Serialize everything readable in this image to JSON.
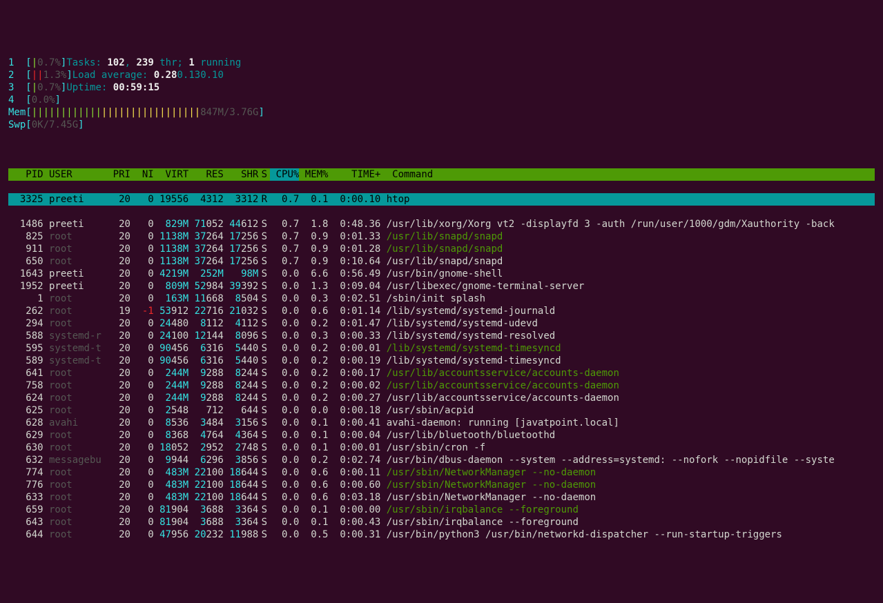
{
  "meters": {
    "cpus": [
      {
        "label": "1",
        "bar": "|",
        "barColor": "green",
        "pct": "0.7%"
      },
      {
        "label": "2",
        "bar": "||",
        "barColor": "red",
        "pct": "1.3%"
      },
      {
        "label": "3",
        "bar": "|",
        "barColor": "green",
        "pct": "0.7%"
      },
      {
        "label": "4",
        "bar": "",
        "barColor": "green",
        "pct": "0.0%"
      }
    ],
    "mem": {
      "label": "Mem",
      "bar": "|||||||||||||||||||||||||||||",
      "used": "847M",
      "total": "3.76G"
    },
    "swp": {
      "label": "Swp",
      "bar": "",
      "used": "0K",
      "total": "7.45G"
    }
  },
  "stats": {
    "tasks_label": "Tasks: ",
    "tasks_procs": "102",
    "tasks_sep": ", ",
    "tasks_thr": "239",
    "tasks_thr_label": " thr; ",
    "tasks_running": "1",
    "tasks_running_label": " running",
    "load_label": "Load average: ",
    "load1": "0.28",
    "load5": "0.13",
    "load15": "0.10",
    "uptime_label": "Uptime: ",
    "uptime": "00:59:15"
  },
  "columns": {
    "pid": "PID",
    "user": "USER",
    "pri": "PRI",
    "ni": "NI",
    "virt": "VIRT",
    "res": "RES",
    "shr": "SHR",
    "s": "S",
    "cpu": "CPU%",
    "mem": "MEM%",
    "time": "TIME+",
    "cmd": "Command"
  },
  "selected": {
    "pid": "3325",
    "user": "preeti",
    "pri": "20",
    "ni": "0",
    "virt": "19556",
    "res": "4312",
    "shr": "3312",
    "s": "R",
    "cpu": "0.7",
    "mem": "0.1",
    "time": "0:00.10",
    "cmd": "htop"
  },
  "processes": [
    {
      "pid": "1486",
      "user": "preeti",
      "userColor": "white",
      "pri": "20",
      "ni": "0",
      "virt": "829M",
      "virtC": "cyan",
      "res_a": "71",
      "res_b": "052",
      "shr_a": "44",
      "shr_b": "612",
      "s": "S",
      "cpu": "0.7",
      "mem": "1.8",
      "time": "0:48.36",
      "cmd": "/usr/lib/xorg/Xorg vt2 -displayfd 3 -auth /run/user/1000/gdm/Xauthority -back",
      "cmdC": "white"
    },
    {
      "pid": "825",
      "user": "root",
      "userColor": "grey",
      "pri": "20",
      "ni": "0",
      "virt": "1138M",
      "virtC": "cyan",
      "res_a": "37",
      "res_b": "264",
      "shr_a": "17",
      "shr_b": "256",
      "s": "S",
      "cpu": "0.7",
      "mem": "0.9",
      "time": "0:01.33",
      "cmd": "/usr/lib/snapd/snapd",
      "cmdC": "green-dim"
    },
    {
      "pid": "911",
      "user": "root",
      "userColor": "grey",
      "pri": "20",
      "ni": "0",
      "virt": "1138M",
      "virtC": "cyan",
      "res_a": "37",
      "res_b": "264",
      "shr_a": "17",
      "shr_b": "256",
      "s": "S",
      "cpu": "0.7",
      "mem": "0.9",
      "time": "0:01.28",
      "cmd": "/usr/lib/snapd/snapd",
      "cmdC": "green-dim"
    },
    {
      "pid": "650",
      "user": "root",
      "userColor": "grey",
      "pri": "20",
      "ni": "0",
      "virt": "1138M",
      "virtC": "cyan",
      "res_a": "37",
      "res_b": "264",
      "shr_a": "17",
      "shr_b": "256",
      "s": "S",
      "cpu": "0.7",
      "mem": "0.9",
      "time": "0:10.64",
      "cmd": "/usr/lib/snapd/snapd",
      "cmdC": "white"
    },
    {
      "pid": "1643",
      "user": "preeti",
      "userColor": "white",
      "pri": "20",
      "ni": "0",
      "virt": "4219M",
      "virtC": "cyan",
      "res_a": "",
      "res_b": "252M",
      "resC": "cyan",
      "shr_a": "",
      "shr_b": "98M",
      "shrC": "cyan",
      "s": "S",
      "cpu": "0.0",
      "mem": "6.6",
      "time": "0:56.49",
      "cmd": "/usr/bin/gnome-shell",
      "cmdC": "white"
    },
    {
      "pid": "1952",
      "user": "preeti",
      "userColor": "white",
      "pri": "20",
      "ni": "0",
      "virt": "809M",
      "virtC": "cyan",
      "res_a": "52",
      "res_b": "984",
      "shr_a": "39",
      "shr_b": "392",
      "s": "S",
      "cpu": "0.0",
      "mem": "1.3",
      "time": "0:09.04",
      "cmd": "/usr/libexec/gnome-terminal-server",
      "cmdC": "white"
    },
    {
      "pid": "1",
      "user": "root",
      "userColor": "grey",
      "pri": "20",
      "ni": "0",
      "virt": "163M",
      "virtC": "cyan",
      "res_a": "11",
      "res_b": "668",
      "shr_a": "8",
      "shr_b": "504",
      "s": "S",
      "cpu": "0.0",
      "mem": "0.3",
      "time": "0:02.51",
      "cmd": "/sbin/init splash",
      "cmdC": "white"
    },
    {
      "pid": "262",
      "user": "root",
      "userColor": "grey",
      "pri": "19",
      "ni": "-1",
      "niC": "red",
      "virt": "53912",
      "virtC": "cyan-split",
      "virt_a": "53",
      "virt_b": "912",
      "res_a": "22",
      "res_b": "716",
      "shr_a": "21",
      "shr_b": "032",
      "s": "S",
      "cpu": "0.0",
      "mem": "0.6",
      "time": "0:01.14",
      "cmd": "/lib/systemd/systemd-journald",
      "cmdC": "white"
    },
    {
      "pid": "294",
      "user": "root",
      "userColor": "grey",
      "pri": "20",
      "ni": "0",
      "virt": "24480",
      "virtC": "cyan-split",
      "virt_a": "24",
      "virt_b": "480",
      "res_a": "8",
      "res_b": "112",
      "shr_a": "4",
      "shr_b": "112",
      "s": "S",
      "cpu": "0.0",
      "mem": "0.2",
      "time": "0:01.47",
      "cmd": "/lib/systemd/systemd-udevd",
      "cmdC": "white"
    },
    {
      "pid": "588",
      "user": "systemd-r",
      "userColor": "grey",
      "pri": "20",
      "ni": "0",
      "virt": "24100",
      "virtC": "cyan-split",
      "virt_a": "24",
      "virt_b": "100",
      "res_a": "12",
      "res_b": "144",
      "shr_a": "8",
      "shr_b": "096",
      "s": "S",
      "cpu": "0.0",
      "mem": "0.3",
      "time": "0:00.33",
      "cmd": "/lib/systemd/systemd-resolved",
      "cmdC": "white"
    },
    {
      "pid": "595",
      "user": "systemd-t",
      "userColor": "grey",
      "pri": "20",
      "ni": "0",
      "virt": "90456",
      "virtC": "cyan-split",
      "virt_a": "90",
      "virt_b": "456",
      "res_a": "6",
      "res_b": "316",
      "shr_a": "5",
      "shr_b": "440",
      "s": "S",
      "cpu": "0.0",
      "mem": "0.2",
      "time": "0:00.01",
      "cmd": "/lib/systemd/systemd-timesyncd",
      "cmdC": "green-dim"
    },
    {
      "pid": "589",
      "user": "systemd-t",
      "userColor": "grey",
      "pri": "20",
      "ni": "0",
      "virt": "90456",
      "virtC": "cyan-split",
      "virt_a": "90",
      "virt_b": "456",
      "res_a": "6",
      "res_b": "316",
      "shr_a": "5",
      "shr_b": "440",
      "s": "S",
      "cpu": "0.0",
      "mem": "0.2",
      "time": "0:00.19",
      "cmd": "/lib/systemd/systemd-timesyncd",
      "cmdC": "white"
    },
    {
      "pid": "641",
      "user": "root",
      "userColor": "grey",
      "pri": "20",
      "ni": "0",
      "virt": "244M",
      "virtC": "cyan",
      "res_a": "9",
      "res_b": "288",
      "shr_a": "8",
      "shr_b": "244",
      "s": "S",
      "cpu": "0.0",
      "mem": "0.2",
      "time": "0:00.17",
      "cmd": "/usr/lib/accountsservice/accounts-daemon",
      "cmdC": "green-dim"
    },
    {
      "pid": "758",
      "user": "root",
      "userColor": "grey",
      "pri": "20",
      "ni": "0",
      "virt": "244M",
      "virtC": "cyan",
      "res_a": "9",
      "res_b": "288",
      "shr_a": "8",
      "shr_b": "244",
      "s": "S",
      "cpu": "0.0",
      "mem": "0.2",
      "time": "0:00.02",
      "cmd": "/usr/lib/accountsservice/accounts-daemon",
      "cmdC": "green-dim"
    },
    {
      "pid": "624",
      "user": "root",
      "userColor": "grey",
      "pri": "20",
      "ni": "0",
      "virt": "244M",
      "virtC": "cyan",
      "res_a": "9",
      "res_b": "288",
      "shr_a": "8",
      "shr_b": "244",
      "s": "S",
      "cpu": "0.0",
      "mem": "0.2",
      "time": "0:00.27",
      "cmd": "/usr/lib/accountsservice/accounts-daemon",
      "cmdC": "white"
    },
    {
      "pid": "625",
      "user": "root",
      "userColor": "grey",
      "pri": "20",
      "ni": "0",
      "virt": "2548",
      "virtC": "cyan-split",
      "virt_a": "2",
      "virt_b": "548",
      "res_a": "",
      "res_b": "712",
      "shr_a": "",
      "shr_b": "644",
      "s": "S",
      "cpu": "0.0",
      "mem": "0.0",
      "time": "0:00.18",
      "cmd": "/usr/sbin/acpid",
      "cmdC": "white"
    },
    {
      "pid": "628",
      "user": "avahi",
      "userColor": "grey",
      "pri": "20",
      "ni": "0",
      "virt": "8536",
      "virtC": "cyan-split",
      "virt_a": "8",
      "virt_b": "536",
      "res_a": "3",
      "res_b": "484",
      "shr_a": "3",
      "shr_b": "156",
      "s": "S",
      "cpu": "0.0",
      "mem": "0.1",
      "time": "0:00.41",
      "cmd": "avahi-daemon: running [javatpoint.local]",
      "cmdC": "white"
    },
    {
      "pid": "629",
      "user": "root",
      "userColor": "grey",
      "pri": "20",
      "ni": "0",
      "virt": "8368",
      "virtC": "cyan-split",
      "virt_a": "8",
      "virt_b": "368",
      "res_a": "4",
      "res_b": "764",
      "shr_a": "4",
      "shr_b": "364",
      "s": "S",
      "cpu": "0.0",
      "mem": "0.1",
      "time": "0:00.04",
      "cmd": "/usr/lib/bluetooth/bluetoothd",
      "cmdC": "white"
    },
    {
      "pid": "630",
      "user": "root",
      "userColor": "grey",
      "pri": "20",
      "ni": "0",
      "virt": "18052",
      "virtC": "cyan-split",
      "virt_a": "18",
      "virt_b": "052",
      "res_a": "2",
      "res_b": "952",
      "shr_a": "2",
      "shr_b": "748",
      "s": "S",
      "cpu": "0.0",
      "mem": "0.1",
      "time": "0:00.01",
      "cmd": "/usr/sbin/cron -f",
      "cmdC": "white"
    },
    {
      "pid": "632",
      "user": "messagebu",
      "userColor": "grey",
      "pri": "20",
      "ni": "0",
      "virt": "9944",
      "virtC": "cyan-split",
      "virt_a": "9",
      "virt_b": "944",
      "res_a": "6",
      "res_b": "296",
      "shr_a": "3",
      "shr_b": "856",
      "s": "S",
      "cpu": "0.0",
      "mem": "0.2",
      "time": "0:02.74",
      "cmd": "/usr/bin/dbus-daemon --system --address=systemd: --nofork --nopidfile --syste",
      "cmdC": "white"
    },
    {
      "pid": "774",
      "user": "root",
      "userColor": "grey",
      "pri": "20",
      "ni": "0",
      "virt": "483M",
      "virtC": "cyan",
      "res_a": "22",
      "res_b": "100",
      "shr_a": "18",
      "shr_b": "644",
      "s": "S",
      "cpu": "0.0",
      "mem": "0.6",
      "time": "0:00.11",
      "cmd": "/usr/sbin/NetworkManager --no-daemon",
      "cmdC": "green-dim"
    },
    {
      "pid": "776",
      "user": "root",
      "userColor": "grey",
      "pri": "20",
      "ni": "0",
      "virt": "483M",
      "virtC": "cyan",
      "res_a": "22",
      "res_b": "100",
      "shr_a": "18",
      "shr_b": "644",
      "s": "S",
      "cpu": "0.0",
      "mem": "0.6",
      "time": "0:00.60",
      "cmd": "/usr/sbin/NetworkManager --no-daemon",
      "cmdC": "green-dim"
    },
    {
      "pid": "633",
      "user": "root",
      "userColor": "grey",
      "pri": "20",
      "ni": "0",
      "virt": "483M",
      "virtC": "cyan",
      "res_a": "22",
      "res_b": "100",
      "shr_a": "18",
      "shr_b": "644",
      "s": "S",
      "cpu": "0.0",
      "mem": "0.6",
      "time": "0:03.18",
      "cmd": "/usr/sbin/NetworkManager --no-daemon",
      "cmdC": "white"
    },
    {
      "pid": "659",
      "user": "root",
      "userColor": "grey",
      "pri": "20",
      "ni": "0",
      "virt": "81904",
      "virtC": "cyan-split",
      "virt_a": "81",
      "virt_b": "904",
      "res_a": "3",
      "res_b": "688",
      "shr_a": "3",
      "shr_b": "364",
      "s": "S",
      "cpu": "0.0",
      "mem": "0.1",
      "time": "0:00.00",
      "cmd": "/usr/sbin/irqbalance --foreground",
      "cmdC": "green-dim"
    },
    {
      "pid": "643",
      "user": "root",
      "userColor": "grey",
      "pri": "20",
      "ni": "0",
      "virt": "81904",
      "virtC": "cyan-split",
      "virt_a": "81",
      "virt_b": "904",
      "res_a": "3",
      "res_b": "688",
      "shr_a": "3",
      "shr_b": "364",
      "s": "S",
      "cpu": "0.0",
      "mem": "0.1",
      "time": "0:00.43",
      "cmd": "/usr/sbin/irqbalance --foreground",
      "cmdC": "white"
    },
    {
      "pid": "644",
      "user": "root",
      "userColor": "grey",
      "pri": "20",
      "ni": "0",
      "virt": "47956",
      "virtC": "cyan-split",
      "virt_a": "47",
      "virt_b": "956",
      "res_a": "20",
      "res_b": "232",
      "shr_a": "11",
      "shr_b": "988",
      "s": "S",
      "cpu": "0.0",
      "mem": "0.5",
      "time": "0:00.31",
      "cmd": "/usr/bin/python3 /usr/bin/networkd-dispatcher --run-startup-triggers",
      "cmdC": "white"
    }
  ]
}
